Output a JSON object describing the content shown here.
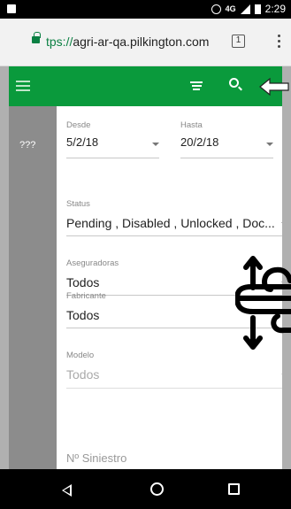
{
  "statusbar": {
    "network": "4G",
    "time": "2:29"
  },
  "browser": {
    "url_scheme": "tps://",
    "url_host": "agri-ar-qa.pilkington.com",
    "tab_count": "1"
  },
  "sidebar": {
    "text": "???"
  },
  "form": {
    "desde": {
      "label": "Desde",
      "value": "5/2/18"
    },
    "hasta": {
      "label": "Hasta",
      "value": "20/2/18"
    },
    "status": {
      "label": "Status",
      "value": "Pending , Disabled , Unlocked , Doc..."
    },
    "aseguradoras": {
      "label": "Aseguradoras",
      "value": "Todos"
    },
    "fabricante": {
      "label": "Fabricante",
      "value": "Todos"
    },
    "modelo": {
      "label": "Modelo",
      "value": "Todos"
    },
    "siniestro": {
      "placeholder": "Nº Siniestro"
    }
  },
  "colors": {
    "accent": "#0a9a3c",
    "secure": "#0b8043"
  },
  "icons": [
    "menu-icon",
    "filter-icon",
    "search-icon",
    "arrow-left-icon",
    "gesture-icon",
    "back-icon",
    "home-icon",
    "recents-icon"
  ]
}
